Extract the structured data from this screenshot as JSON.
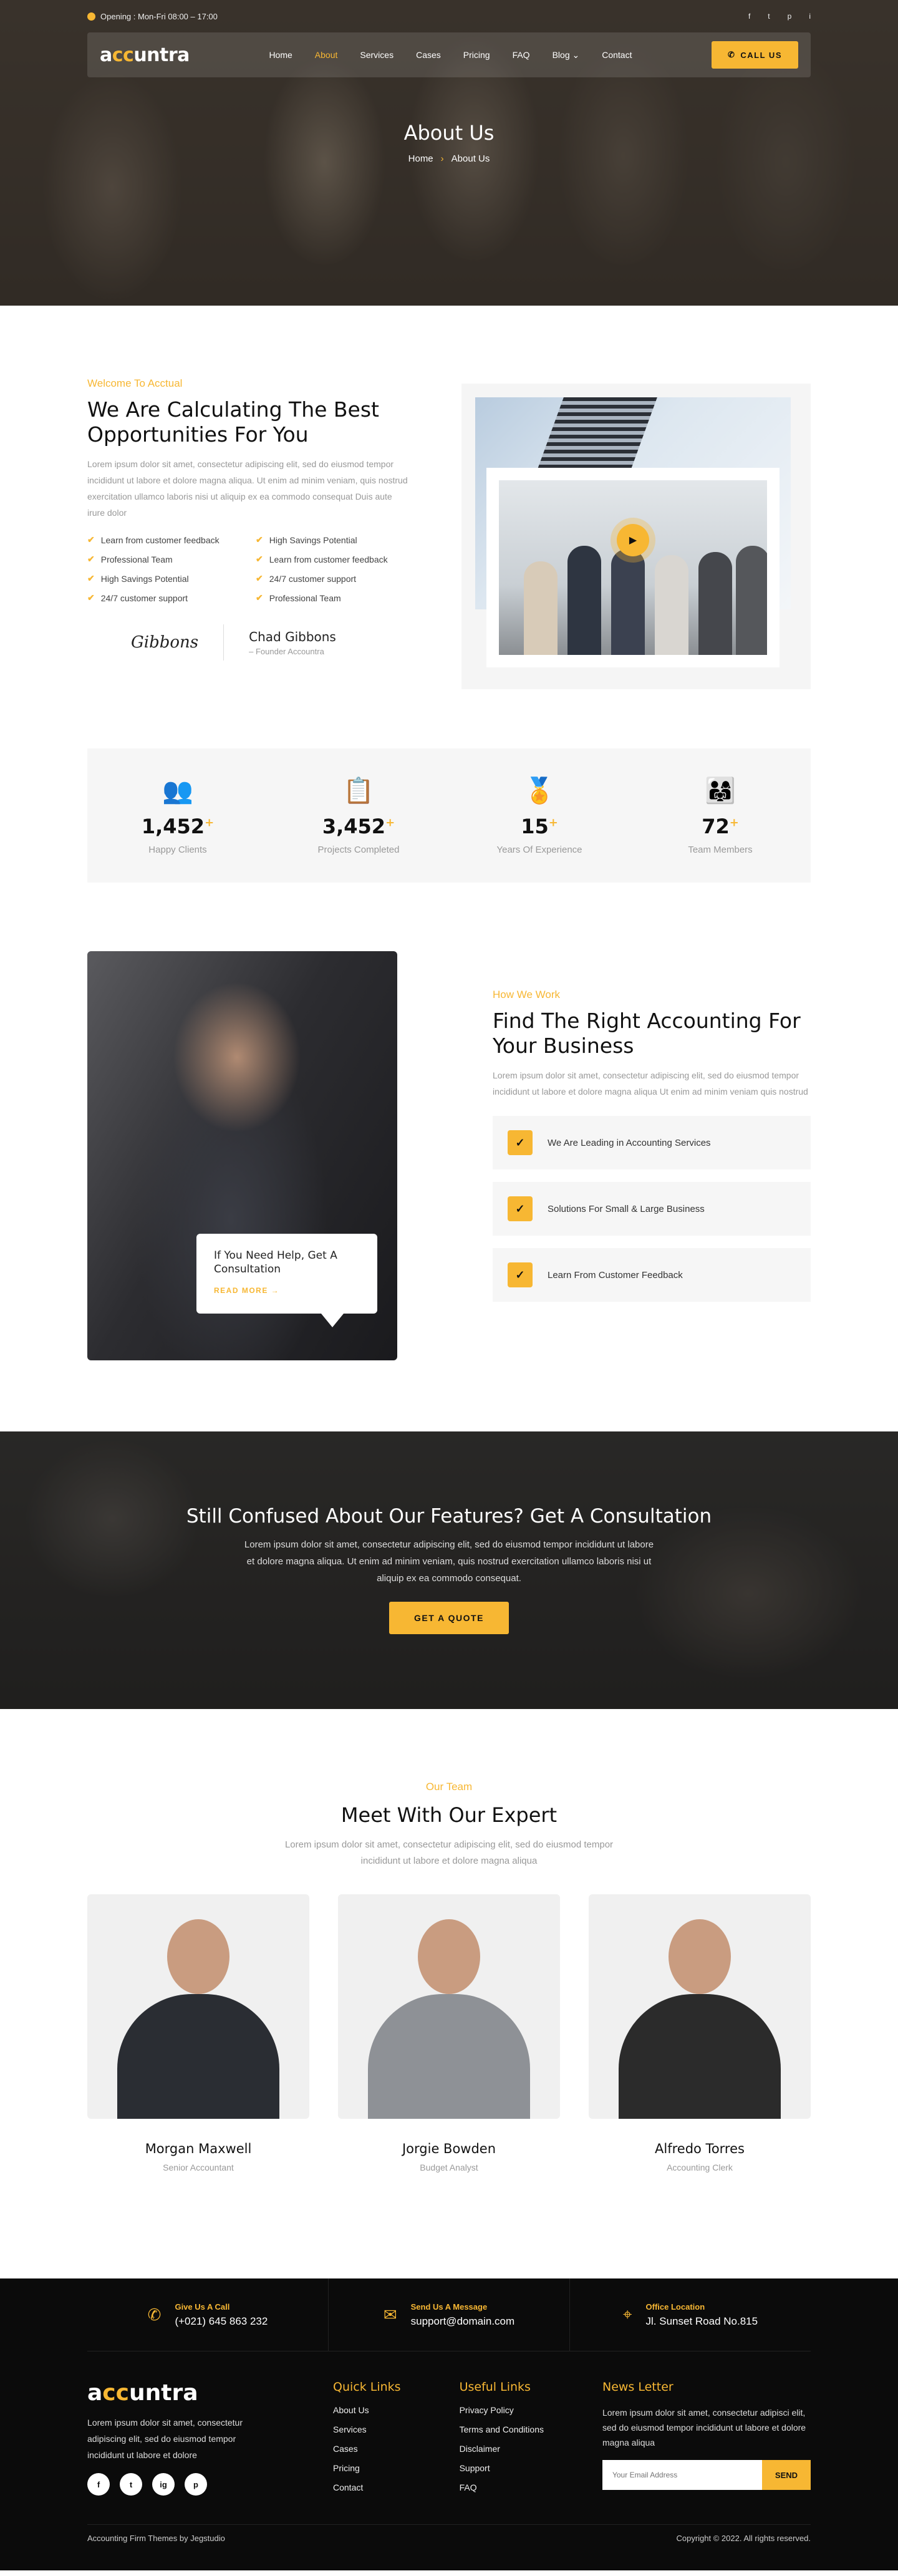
{
  "topbar": {
    "opening": "Opening : Mon-Fri 08:00 – 17:00",
    "socials": [
      "f",
      "t",
      "p",
      "i"
    ]
  },
  "brand": {
    "logo_a": "a",
    "logo_oo": "cc",
    "logo_rest": "untra"
  },
  "nav": {
    "items": [
      {
        "label": "Home",
        "active": false
      },
      {
        "label": "About",
        "active": true
      },
      {
        "label": "Services",
        "active": false
      },
      {
        "label": "Cases",
        "active": false
      },
      {
        "label": "Pricing",
        "active": false
      },
      {
        "label": "FAQ",
        "active": false
      },
      {
        "label": "Blog",
        "active": false
      },
      {
        "label": "Contact",
        "active": false
      }
    ],
    "call_label": "CALL US"
  },
  "hero": {
    "title": "About Us",
    "crumb_home": "Home",
    "crumb_current": "About Us"
  },
  "about": {
    "tagline": "Welcome To Acctual",
    "heading": "We Are Calculating The Best Opportunities For You",
    "paragraph": "Lorem ipsum dolor sit amet, consectetur adipiscing elit, sed do eiusmod tempor incididunt ut labore et dolore magna aliqua. Ut enim ad minim veniam, quis nostrud exercitation ullamco laboris nisi ut aliquip ex ea commodo consequat Duis aute irure dolor",
    "checks": [
      "Learn from customer feedback",
      "High Savings Potential",
      "Professional Team",
      "Learn from customer feedback",
      "High Savings Potential",
      "24/7 customer support",
      "24/7 customer support",
      "Professional Team"
    ],
    "signature": "Gibbons",
    "founder_name": "Chad Gibbons",
    "founder_role": "– Founder Accountra"
  },
  "stats": [
    {
      "icon": "users-icon",
      "glyph": "👥",
      "value": "1,452",
      "label": "Happy Clients"
    },
    {
      "icon": "document-icon",
      "glyph": "📋",
      "value": "3,452",
      "label": "Projects Completed"
    },
    {
      "icon": "award-icon",
      "glyph": "🏅",
      "value": "15",
      "label": "Years Of Experience"
    },
    {
      "icon": "team-icon",
      "glyph": "👨‍👩‍👧",
      "value": "72",
      "label": "Team Members"
    }
  ],
  "how": {
    "tagline": "How We Work",
    "heading": "Find The Right Accounting For Your Business",
    "paragraph": "Lorem ipsum dolor sit amet, consectetur adipiscing elit, sed do eiusmod tempor incididunt ut labore et dolore magna aliqua Ut enim ad minim veniam quis nostrud",
    "help_text": "If You Need Help, Get A Consultation",
    "read_more": "READ MORE →",
    "features": [
      "We Are Leading in Accounting Services",
      "Solutions For Small & Large Business",
      "Learn From Customer Feedback"
    ]
  },
  "cta": {
    "heading": "Still Confused About Our Features? Get A Consultation",
    "paragraph": "Lorem ipsum dolor sit amet, consectetur adipiscing elit, sed do eiusmod tempor incididunt ut labore et dolore magna aliqua. Ut enim ad minim veniam, quis nostrud exercitation ullamco laboris nisi ut aliquip ex ea commodo consequat.",
    "button": "GET A QUOTE"
  },
  "team": {
    "tagline": "Our Team",
    "heading": "Meet With Our Expert",
    "paragraph": "Lorem ipsum dolor sit amet, consectetur adipiscing elit, sed do eiusmod tempor incididunt ut labore et dolore magna aliqua",
    "members": [
      {
        "name": "Morgan Maxwell",
        "role": "Senior Accountant",
        "suit": "#2a2d33"
      },
      {
        "name": "Jorgie Bowden",
        "role": "Budget Analyst",
        "suit": "#8e9196"
      },
      {
        "name": "Alfredo Torres",
        "role": "Accounting Clerk",
        "suit": "#2b2b2b"
      }
    ]
  },
  "footer": {
    "contacts": [
      {
        "icon": "phone-icon",
        "glyph": "✆",
        "title": "Give Us A Call",
        "value": "(+021) 645 863 232"
      },
      {
        "icon": "mail-icon",
        "glyph": "✉",
        "title": "Send Us A Message",
        "value": "support@domain.com"
      },
      {
        "icon": "location-icon",
        "glyph": "⌖",
        "title": "Office Location",
        "value": "Jl. Sunset Road No.815"
      }
    ],
    "about_text": "Lorem ipsum dolor sit amet, consectetur adipiscing elit, sed do eiusmod tempor incididunt ut labore et dolore",
    "socials": [
      "f",
      "t",
      "ig",
      "p"
    ],
    "quick_title": "Quick Links",
    "quick_links": [
      "About Us",
      "Services",
      "Cases",
      "Pricing",
      "Contact"
    ],
    "useful_title": "Useful Links",
    "useful_links": [
      "Privacy Policy",
      "Terms and Conditions",
      "Disclaimer",
      "Support",
      "FAQ"
    ],
    "news_title": "News Letter",
    "news_text": "Lorem ipsum dolor sit amet, consectetur adipisci elit, sed do eiusmod tempor incididunt ut labore et dolore magna aliqua",
    "email_placeholder": "Your Email Address",
    "send_label": "SEND",
    "credit": "Accounting Firm Themes by Jegstudio",
    "copyright": "Copyright © 2022. All rights reserved."
  }
}
